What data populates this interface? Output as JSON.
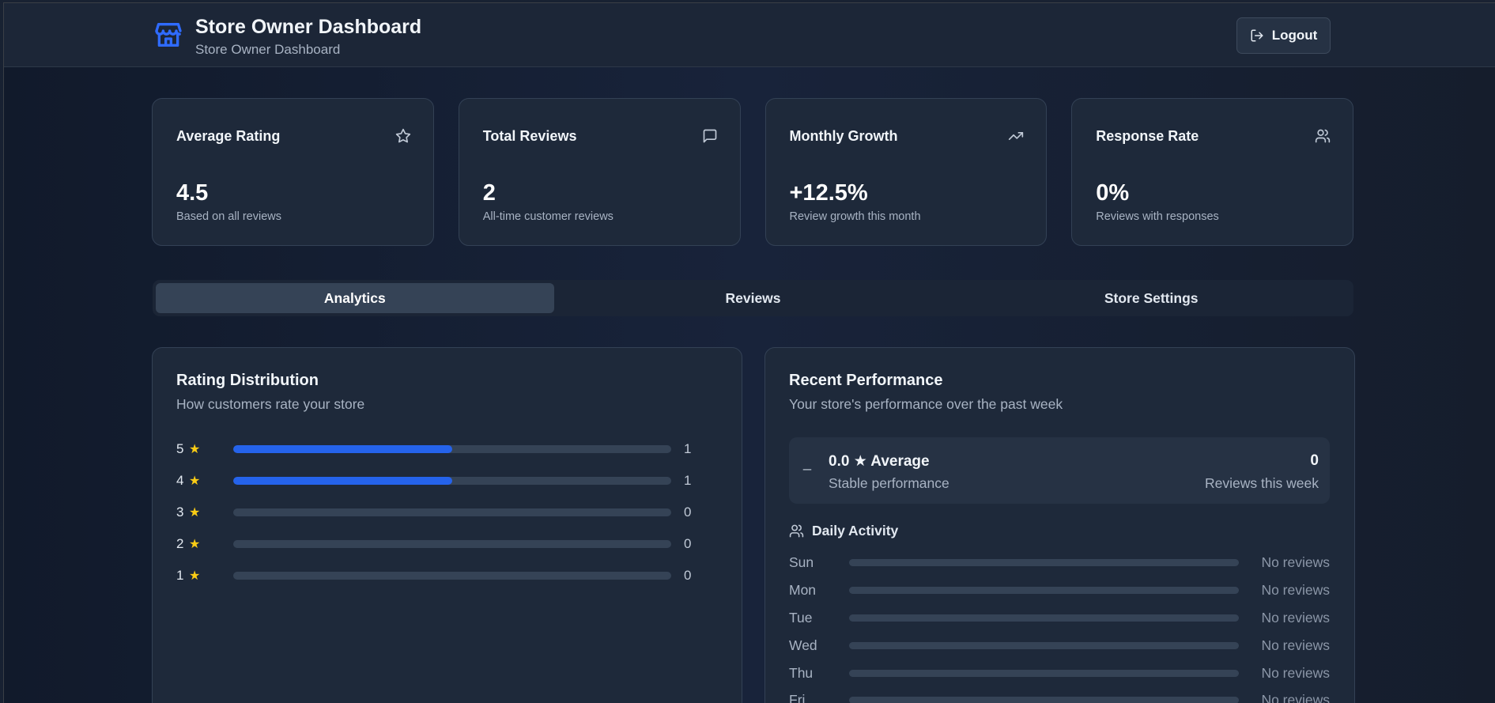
{
  "header": {
    "title": "Store Owner Dashboard",
    "subtitle": "Store Owner Dashboard",
    "logout_label": "Logout"
  },
  "stats": [
    {
      "title": "Average Rating",
      "value": "4.5",
      "desc": "Based on all reviews",
      "icon": "star-icon"
    },
    {
      "title": "Total Reviews",
      "value": "2",
      "desc": "All-time customer reviews",
      "icon": "message-square-icon"
    },
    {
      "title": "Monthly Growth",
      "value": "+12.5%",
      "desc": "Review growth this month",
      "icon": "trending-up-icon"
    },
    {
      "title": "Response Rate",
      "value": "0%",
      "desc": "Reviews with responses",
      "icon": "users-icon"
    }
  ],
  "tabs": [
    {
      "label": "Analytics",
      "active": true
    },
    {
      "label": "Reviews",
      "active": false
    },
    {
      "label": "Store Settings",
      "active": false
    }
  ],
  "rating_distribution": {
    "title": "Rating Distribution",
    "subtitle": "How customers rate your store",
    "rows": [
      {
        "stars": "5",
        "count": "1",
        "fraction": 0.5
      },
      {
        "stars": "4",
        "count": "1",
        "fraction": 0.5
      },
      {
        "stars": "3",
        "count": "0",
        "fraction": 0
      },
      {
        "stars": "2",
        "count": "0",
        "fraction": 0
      },
      {
        "stars": "1",
        "count": "0",
        "fraction": 0
      }
    ]
  },
  "recent_performance": {
    "title": "Recent Performance",
    "subtitle": "Your store's performance over the past week",
    "trend_symbol": "_",
    "average_text": "0.0 ★ Average",
    "status": "Stable performance",
    "week_count": "0",
    "week_label": "Reviews this week",
    "daily_title": "Daily Activity",
    "days": [
      {
        "day": "Sun",
        "note": "No reviews"
      },
      {
        "day": "Mon",
        "note": "No reviews"
      },
      {
        "day": "Tue",
        "note": "No reviews"
      },
      {
        "day": "Wed",
        "note": "No reviews"
      },
      {
        "day": "Thu",
        "note": "No reviews"
      },
      {
        "day": "Fri",
        "note": "No reviews"
      }
    ]
  },
  "colors": {
    "accent": "#2563eb",
    "star": "#facc15",
    "card_bg": "#1e293a"
  }
}
